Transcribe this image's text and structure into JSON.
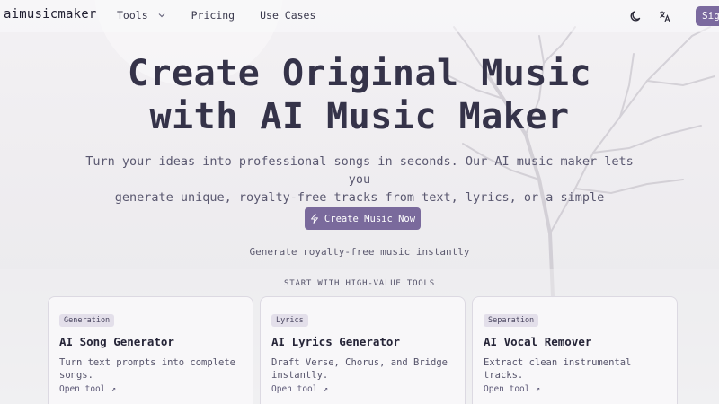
{
  "nav": {
    "logo": "aimusicmaker",
    "links": [
      {
        "label": "Tools",
        "has_dropdown": true
      },
      {
        "label": "Pricing"
      },
      {
        "label": "Use Cases"
      }
    ],
    "theme_icon": "moon-icon",
    "language_icon": "translate-icon",
    "signin_label": "Sig"
  },
  "hero": {
    "title_line1": "Create Original Music",
    "title_line2": "with AI Music Maker",
    "subtitle_line1": "Turn your ideas into professional songs in seconds. Our AI music maker lets you",
    "subtitle_line2": "generate unique, royalty-free tracks from text, lyrics, or a simple description.",
    "cta_label": "Create Music Now",
    "cta_icon": "lightning-icon",
    "hint": "Generate royalty-free music instantly"
  },
  "tools_section": {
    "label": "START WITH HIGH-VALUE TOOLS",
    "cards": [
      {
        "badge": "Generation",
        "title": "AI Song Generator",
        "desc": "Turn text prompts into complete songs.",
        "link": "Open tool ↗"
      },
      {
        "badge": "Lyrics",
        "title": "AI Lyrics Generator",
        "desc": "Draft Verse, Chorus, and Bridge instantly.",
        "link": "Open tool ↗"
      },
      {
        "badge": "Separation",
        "title": "AI Vocal Remover",
        "desc": "Extract clean instrumental tracks.",
        "link": "Open tool ↗"
      }
    ]
  },
  "colors": {
    "accent": "#7a6a9c",
    "text_dark": "#353349",
    "badge_bg": "#e3dfea"
  }
}
